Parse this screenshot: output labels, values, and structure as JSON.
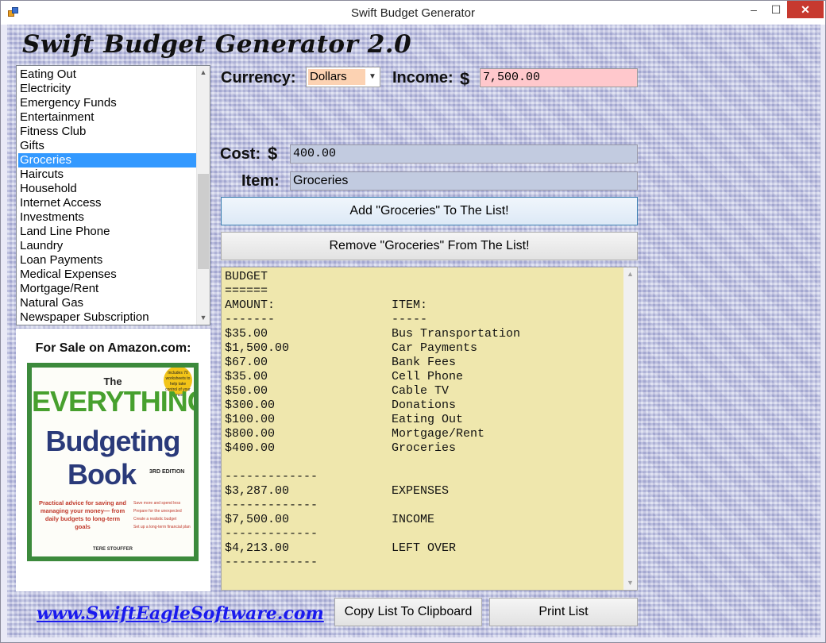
{
  "window": {
    "title": "Swift Budget Generator",
    "minimize_glyph": "–",
    "maximize_glyph": "☐",
    "close_glyph": "✕"
  },
  "app_heading": "Swift Budget Generator 2.0",
  "categories": {
    "items": [
      "Eating Out",
      "Electricity",
      "Emergency Funds",
      "Entertainment",
      "Fitness Club",
      "Gifts",
      "Groceries",
      "Haircuts",
      "Household",
      "Internet Access",
      "Investments",
      "Land Line Phone",
      "Laundry",
      "Loan Payments",
      "Medical Expenses",
      "Mortgage/Rent",
      "Natural Gas",
      "Newspaper Subscription"
    ],
    "selected": "Groceries"
  },
  "promo": {
    "label": "For Sale on Amazon.com:",
    "book": {
      "the": "The",
      "line1": "EVERYTHING",
      "line2": "Budgeting",
      "line3": "Book",
      "edition": "3RD EDITION",
      "badge": "Includes 70 worksheets to help take control of your finances!",
      "description": "Practical advice for saving and managing your money— from daily budgets to long-term goals",
      "bullets": [
        "Save more and spend less",
        "Prepare for the unexpected",
        "Create a realistic budget",
        "Set up a long-term financial plan"
      ],
      "author": "TERE STOUFFER"
    }
  },
  "website": "www.SwiftEagleSoftware.com",
  "form": {
    "currency_label": "Currency:",
    "currency_value": "Dollars",
    "income_label": "Income:",
    "dollar_sign": "$",
    "income_value": "7,500.00",
    "cost_label": "Cost:",
    "cost_value": "400.00",
    "item_label": "Item:",
    "item_value": "Groceries"
  },
  "buttons": {
    "add": "Add \"Groceries\" To The List!",
    "remove": "Remove \"Groceries\" From The List!",
    "copy": "Copy List To Clipboard",
    "print": "Print List"
  },
  "budget": {
    "title": "BUDGET",
    "title_rule": "======",
    "amount_header": "AMOUNT:",
    "item_header": "ITEM:",
    "amount_rule": "-------",
    "item_rule": "-----",
    "rows": [
      {
        "amount": "$35.00",
        "item": "Bus Transportation"
      },
      {
        "amount": "$1,500.00",
        "item": "Car Payments"
      },
      {
        "amount": "$67.00",
        "item": "Bank Fees"
      },
      {
        "amount": "$35.00",
        "item": "Cell Phone"
      },
      {
        "amount": "$50.00",
        "item": "Cable TV"
      },
      {
        "amount": "$300.00",
        "item": "Donations"
      },
      {
        "amount": "$100.00",
        "item": "Eating Out"
      },
      {
        "amount": "$800.00",
        "item": "Mortgage/Rent"
      },
      {
        "amount": "$400.00",
        "item": "Groceries"
      }
    ],
    "separator": "-------------",
    "expenses_amount": "$3,287.00",
    "expenses_label": "EXPENSES",
    "income_amount": "$7,500.00",
    "income_label": "INCOME",
    "leftover_amount": "$4,213.00",
    "leftover_label": "LEFT OVER"
  }
}
